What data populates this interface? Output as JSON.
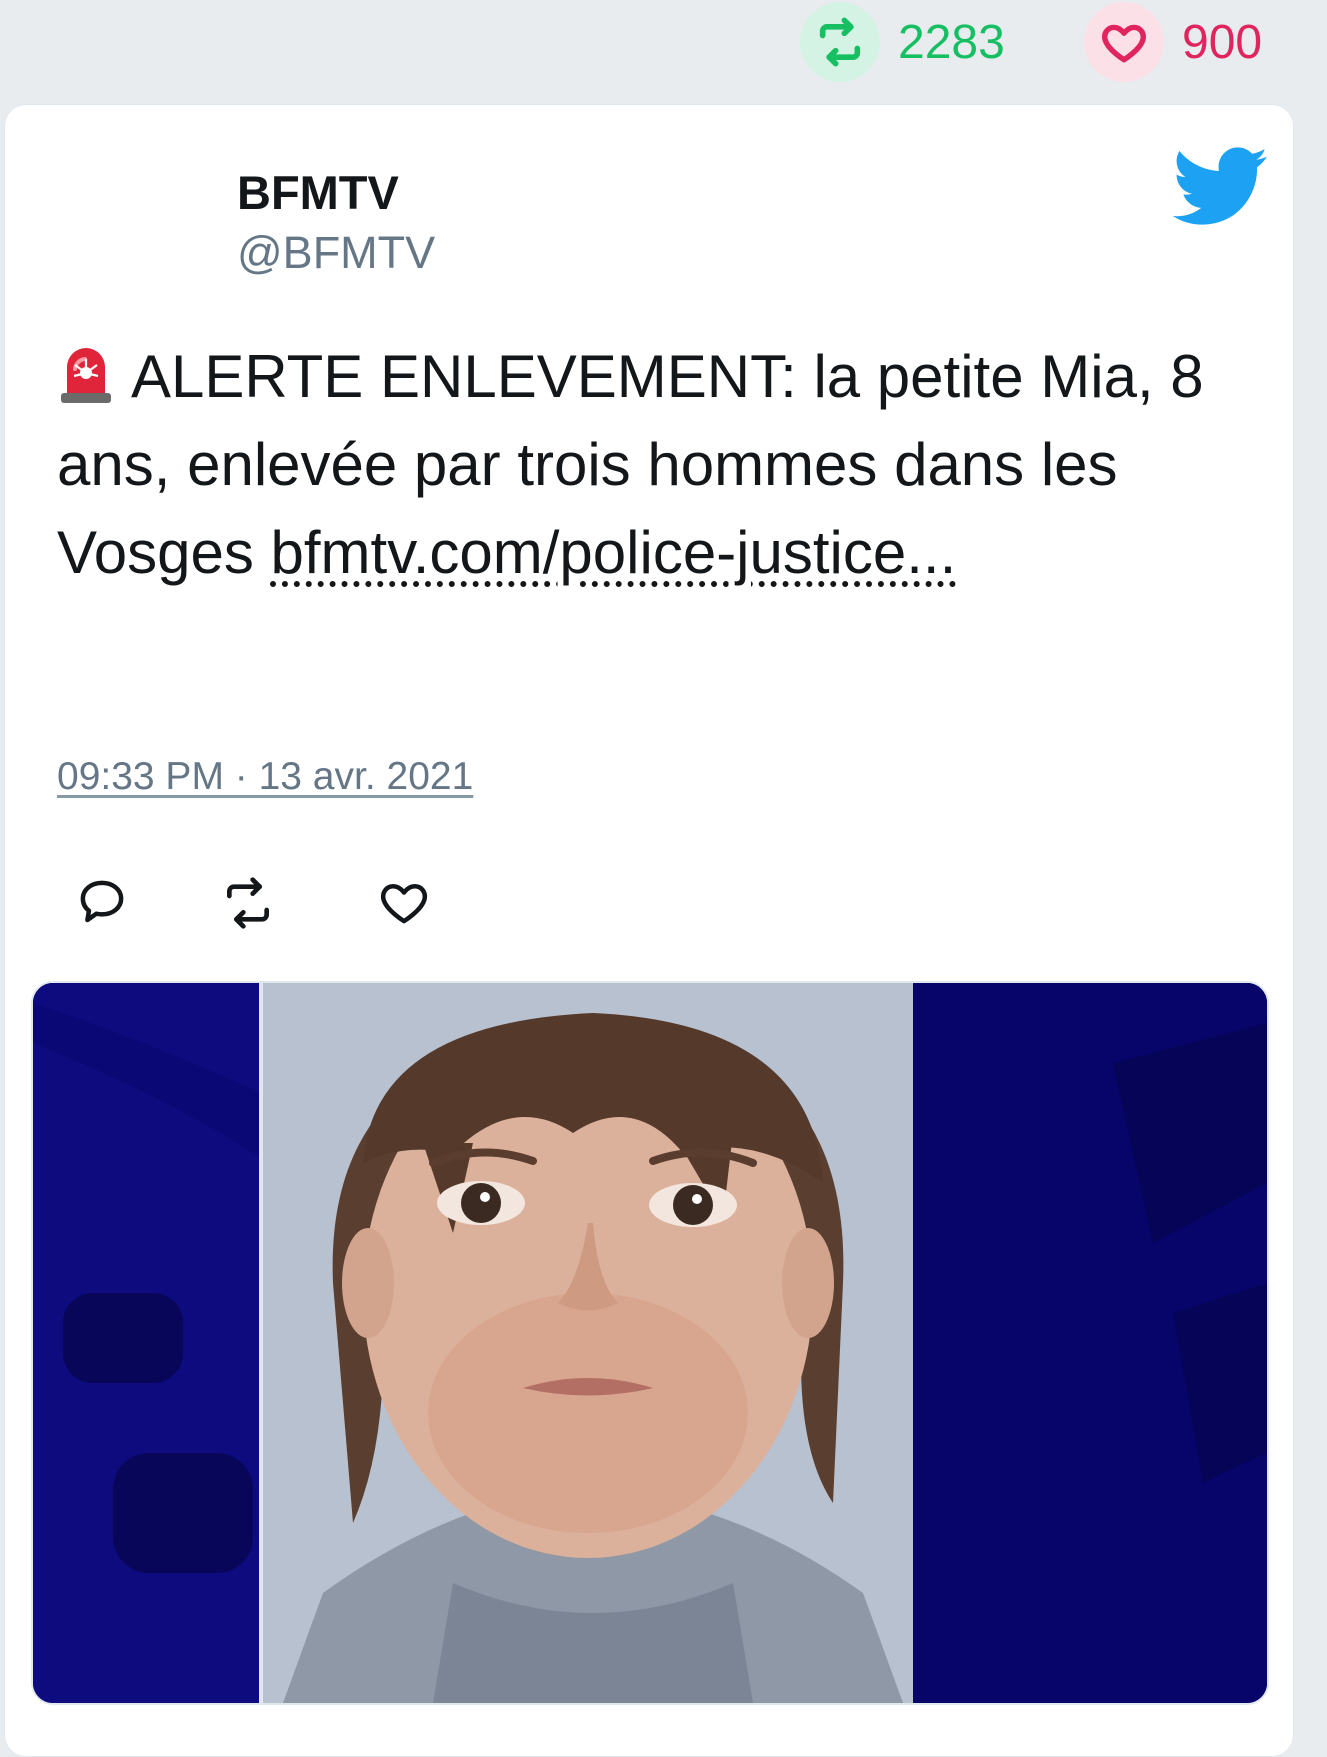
{
  "stats": {
    "retweets": "2283",
    "likes": "900",
    "retweet_icon": "retweet-icon",
    "like_icon": "heart-icon",
    "retweet_color": "#17bf63",
    "like_color": "#e0245e"
  },
  "tweet": {
    "author_name": "BFMTV",
    "author_handle": "@BFMTV",
    "text_emoji": "police-car-light-emoji",
    "text_main": "ALERTE ENLEVEMENT: la petite Mia, 8 ans, enlevée par trois hommes dans les Vosges",
    "link_text": "bfmtv.com/police-justice...",
    "timestamp": "09:33 PM · 13 avr. 2021",
    "brand_icon": "twitter-bird-icon",
    "brand_color": "#1da1f2"
  },
  "actions": {
    "reply_icon": "reply-icon",
    "retweet_icon": "retweet-icon",
    "like_icon": "heart-icon"
  },
  "media": {
    "description_icon": "tweet-photo",
    "background_color": "#0b0a78"
  }
}
